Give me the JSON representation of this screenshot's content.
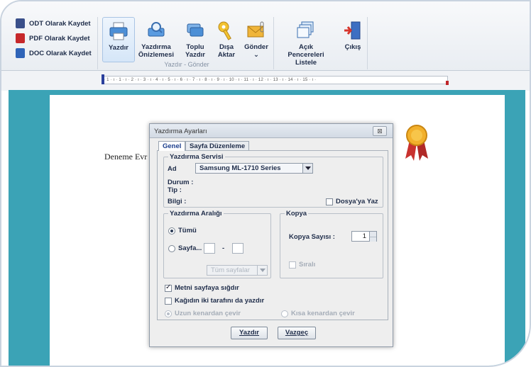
{
  "ribbon": {
    "save_items": [
      {
        "label": "ODT Olarak Kaydet",
        "icon": "odt-file-icon",
        "color": "#3a4f8a"
      },
      {
        "label": "PDF Olarak Kaydet",
        "icon": "pdf-file-icon",
        "color": "#c6282b"
      },
      {
        "label": "DOC Olarak Kaydet",
        "icon": "doc-file-icon",
        "color": "#2f64b8"
      }
    ],
    "print_buttons": {
      "yazdir": "Yazdır",
      "onizleme": "Yazdırma\nÖnizlemesi",
      "toplu": "Toplu\nYazdır",
      "disa": "Dışa\nAktar",
      "gonder": "Gönder\n⌄"
    },
    "print_group_label": "Yazdır - Gönder",
    "window_buttons": {
      "acik": "Açık Pencereleri\nListele",
      "cikis": "Çıkış"
    }
  },
  "ruler": {
    "text": "· 1 · ı · 1 · ı · 2 · ı · 3 · ı · 4 · ı · 5 · ı · 6 · ı · 7 · ı · 8 · ı · 9 · ı · 10 · ı · 11 · ı · 12 · ı · 13 · ı · 14 · ı · 15 · ı ·"
  },
  "document": {
    "text": "Deneme Evr"
  },
  "dialog": {
    "title": "Yazdırma Ayarları",
    "close_label": "⊠",
    "tabs": [
      "Genel",
      "Sayfa Düzenleme"
    ],
    "servis": {
      "title": "Yazdırma Servisi",
      "ad_label": "Ad",
      "printer_value": "Samsung ML-1710 Series",
      "durum_label": "Durum :",
      "tip_label": "Tip :",
      "bilgi_label": "Bilgi :",
      "dosyaya_yaz": "Dosya'ya Yaz"
    },
    "aralik": {
      "title": "Yazdırma Aralığı",
      "tumu": "Tümü",
      "sayfa": "Sayfa...",
      "dash": "-",
      "range_value": "Tüm sayfalar"
    },
    "kopya": {
      "title": "Kopya",
      "sayisi_label": "Kopya Sayısı :",
      "sayisi_value": "1",
      "sirali": "Sıralı"
    },
    "options": {
      "fit_page": "Metni sayfaya sığdır",
      "duplex": "Kağıdın iki tarafını da yazdır",
      "long_edge": "Uzun kenardan çevir",
      "short_edge": "Kısa kenardan çevir"
    },
    "buttons": {
      "ok": "Yazdır",
      "cancel": "Vazgeç"
    }
  },
  "colors": {
    "workspace": "#3ba3b6",
    "rosette_gold": "#f2b02b",
    "rosette_ribbon": "#c9322f"
  }
}
